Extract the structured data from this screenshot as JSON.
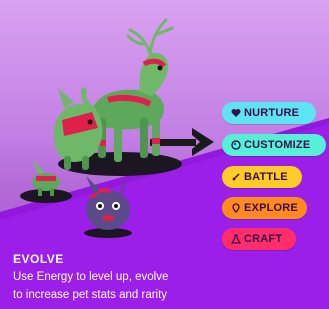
{
  "menu": {
    "items": [
      {
        "label": "NURTURE",
        "color": "#5fe3f2",
        "icon": "heart-icon"
      },
      {
        "label": "CUSTOMIZE",
        "color": "#55f0d8",
        "icon": "palette-icon"
      },
      {
        "label": "BATTLE",
        "color": "#ffcb29",
        "icon": "sword-icon"
      },
      {
        "label": "EXPLORE",
        "color": "#ff8a1e",
        "icon": "map-pin-icon"
      },
      {
        "label": "CRAFT",
        "color": "#ff2d6a",
        "icon": "flask-icon"
      }
    ]
  },
  "caption": {
    "title": "EVOLVE",
    "line1": "Use Energy to level up, evolve",
    "line2": "to increase pet stats and rarity"
  },
  "colors": {
    "sky_top": "#d9a2f0",
    "floor": "#9b1fe8",
    "creature_body": "#6fb86a",
    "creature_accent": "#e0204a",
    "shadow": "#1a1a1a"
  }
}
